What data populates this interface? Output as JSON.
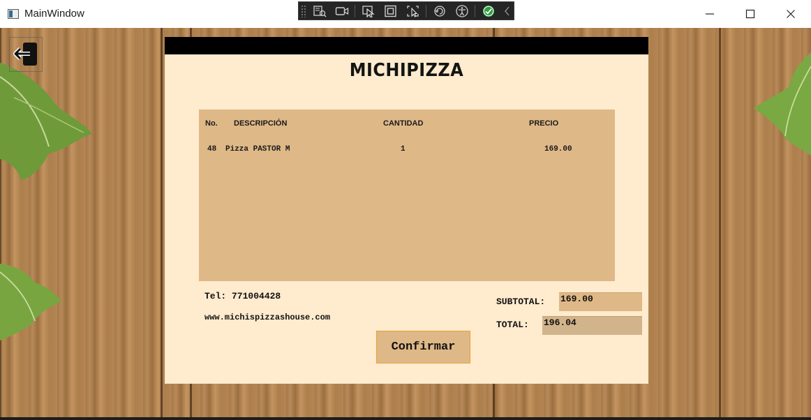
{
  "window": {
    "title": "MainWindow",
    "controls": [
      "minimize-icon",
      "maximize-icon",
      "close-icon"
    ]
  },
  "debug_toolbar": {
    "buttons": [
      "live-visual-tree-icon",
      "track-focus-camera-icon",
      "select-element-icon",
      "display-layout-adorners-icon",
      "preview-selection-icon",
      "hot-reload-icon",
      "accessibility-icon",
      "binding-check-icon",
      "collapse-chevron-icon"
    ]
  },
  "back_button": {
    "icon": "exit-door-icon"
  },
  "receipt": {
    "brand": "MICHIPIZZA",
    "columns": {
      "no": "No.",
      "description": "DESCRIPCIÓN",
      "quantity": "CANTIDAD",
      "price": "PRECIO"
    },
    "rows": [
      {
        "no": "48",
        "description": "Pizza PASTOR M",
        "quantity": "1",
        "price": "169.00"
      }
    ],
    "tel": "Tel: 771004428",
    "website": "www.michispizzashouse.com",
    "subtotal_label": "SUBTOTAL:",
    "subtotal_value": "169.00",
    "total_label": "TOTAL:",
    "total_value": "196.04",
    "confirm_label": "Confirmar"
  },
  "colors": {
    "ticket_bg": "#ffebcd",
    "grid_bg": "#deb887",
    "total_field_bg": "#d2b48c",
    "header_bar": "#000000",
    "confirm_border": "#e8a23a"
  }
}
